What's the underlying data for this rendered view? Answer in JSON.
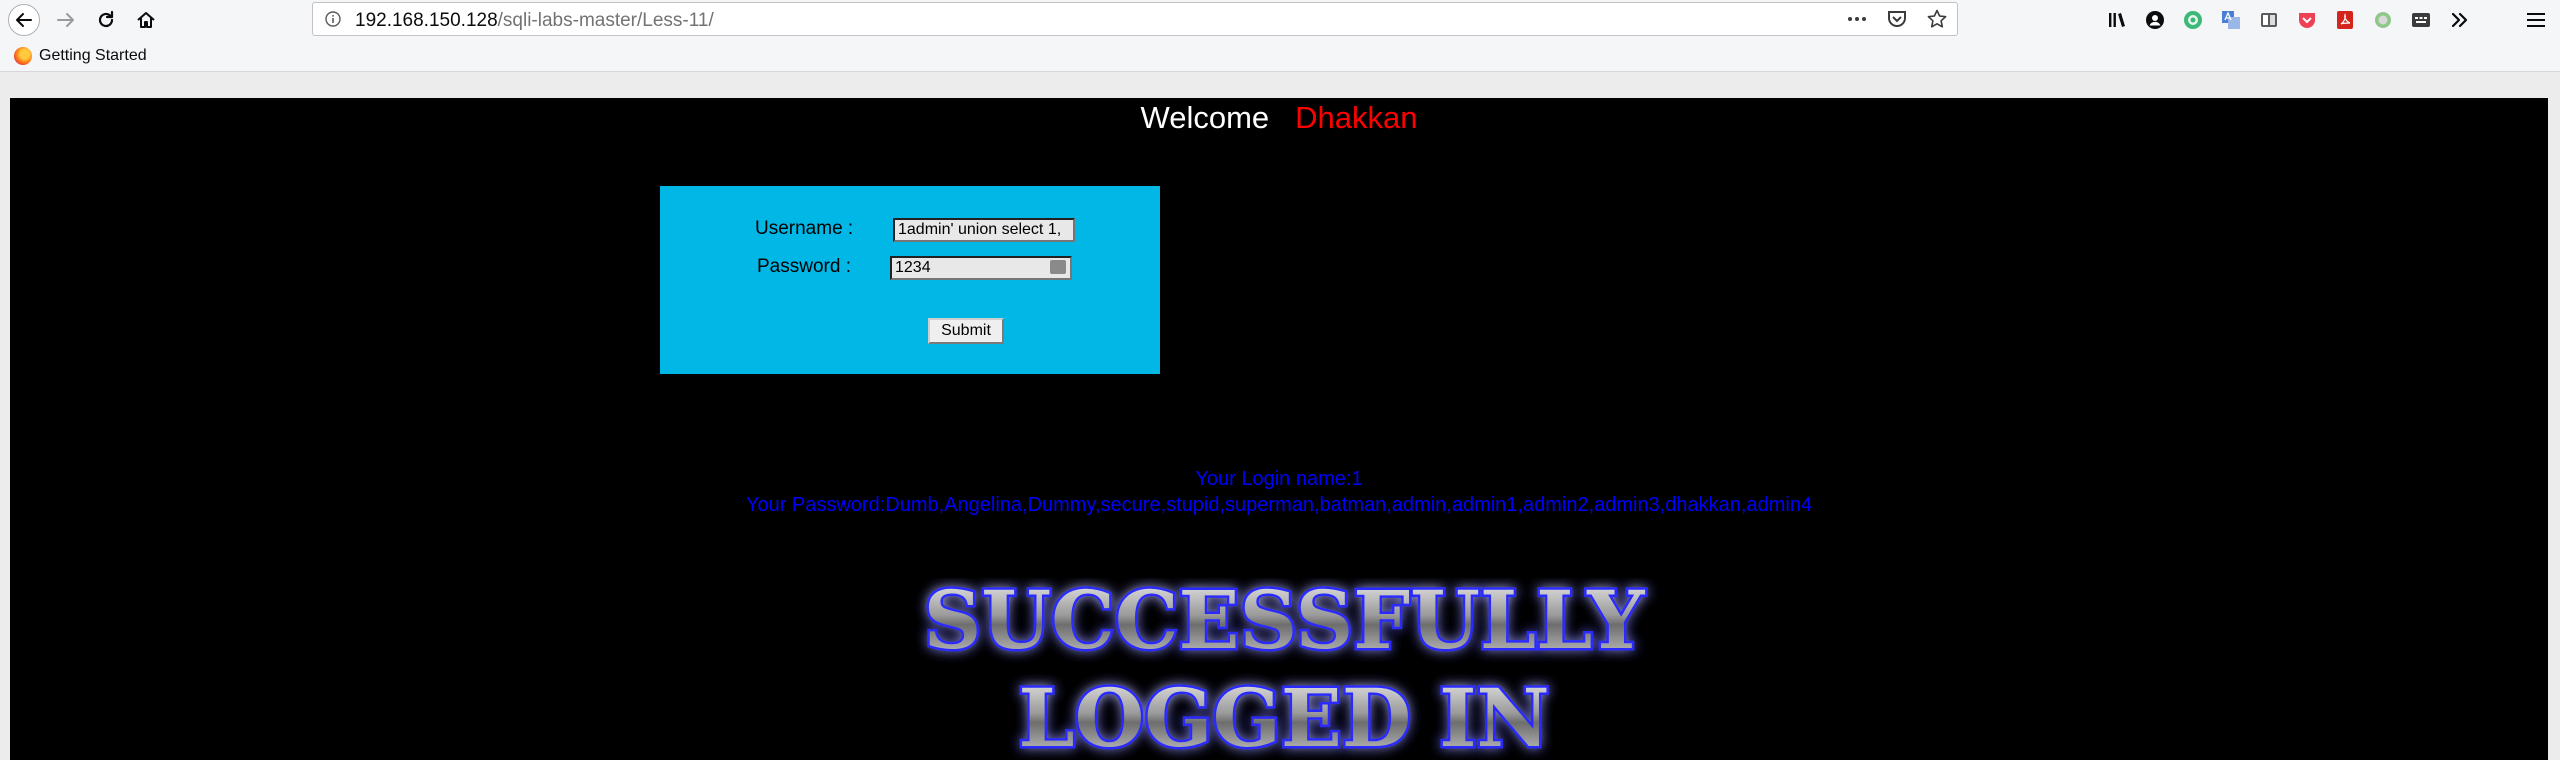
{
  "browser": {
    "url_host": "192.168.150.128",
    "url_path": "/sqli-labs-master/Less-11/",
    "bookmarks": [
      {
        "label": "Getting Started"
      }
    ]
  },
  "page": {
    "welcome_text": "Welcome",
    "welcome_name": "Dhakkan",
    "form": {
      "username_label": "Username :",
      "username_value": "1admin' union select 1,",
      "password_label": "Password :",
      "password_value": "1234",
      "submit_label": "Submit"
    },
    "result": {
      "login_name": "Your Login name:1",
      "password": "Your Password:Dumb,Angelina,Dummy,secure,stupid,superman,batman,admin,admin1,admin2,admin3,dhakkan,admin4"
    },
    "banner": {
      "line1": "SUCCESSFULLY",
      "line2": "LOGGED IN"
    }
  },
  "colors": {
    "page_background": "#000000",
    "welcome_text": "#ffffff",
    "welcome_name": "#ff0000",
    "form_background": "#00b7e6",
    "result_text": "#0000ff",
    "banner_glow": "#2b2bff"
  }
}
